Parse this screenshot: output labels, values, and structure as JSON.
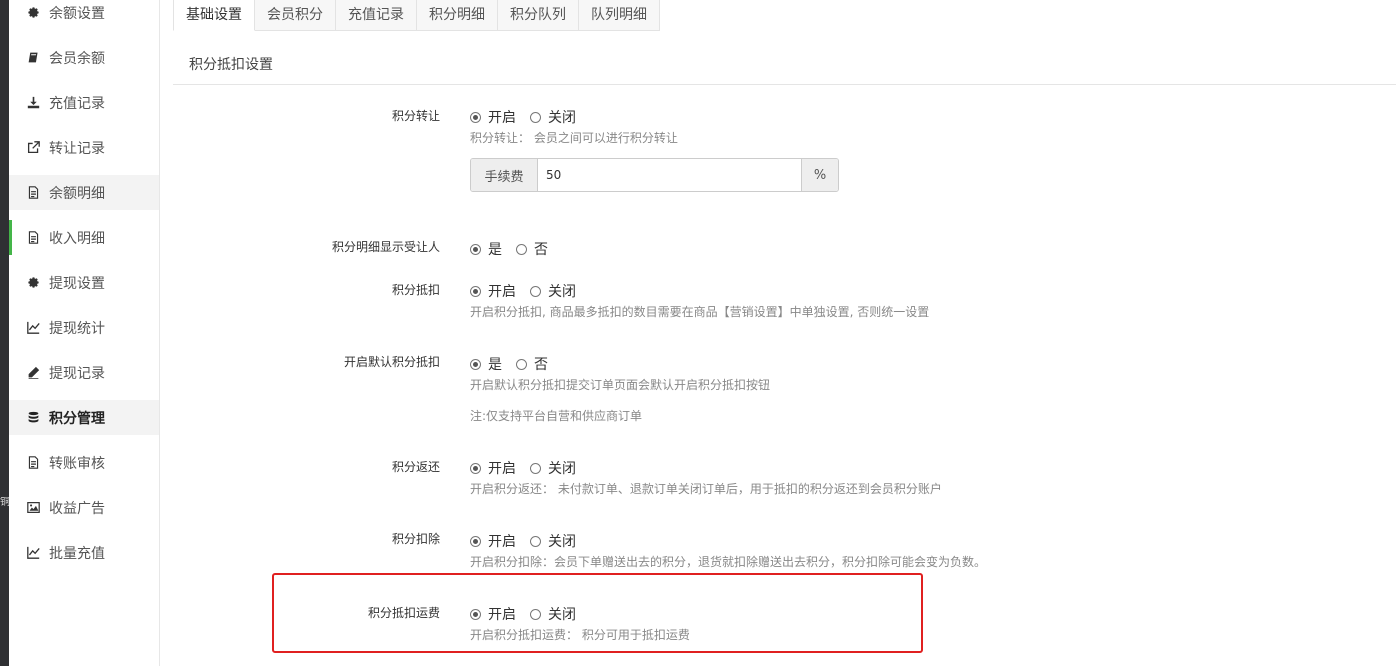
{
  "left_strip_glyph": "铜",
  "sidebar": {
    "items": [
      {
        "label": "余额设置",
        "icon": "gear-icon"
      },
      {
        "label": "会员余额",
        "icon": "book-icon"
      },
      {
        "label": "充值记录",
        "icon": "download-icon"
      },
      {
        "label": "转让记录",
        "icon": "external-link-icon"
      },
      {
        "label": "余额明细",
        "icon": "file-icon"
      },
      {
        "label": "收入明细",
        "icon": "file-icon"
      },
      {
        "label": "提现设置",
        "icon": "gear-icon"
      },
      {
        "label": "提现统计",
        "icon": "line-chart-icon"
      },
      {
        "label": "提现记录",
        "icon": "pencil-icon"
      },
      {
        "label": "积分管理",
        "icon": "database-icon"
      },
      {
        "label": "转账审核",
        "icon": "file-icon"
      },
      {
        "label": "收益广告",
        "icon": "image-icon"
      },
      {
        "label": "批量充值",
        "icon": "line-chart-icon"
      }
    ]
  },
  "tabs": [
    "基础设置",
    "会员积分",
    "充值记录",
    "积分明细",
    "积分队列",
    "队列明细"
  ],
  "section_title": "积分抵扣设置",
  "fields": {
    "transfer": {
      "label": "积分转让",
      "options": [
        "开启",
        "关闭"
      ],
      "selected": 0,
      "help": "积分转让： 会员之间可以进行积分转让",
      "fee_label": "手续费",
      "fee_value": "50",
      "fee_unit": "%"
    },
    "show_receiver": {
      "label": "积分明细显示受让人",
      "options": [
        "是",
        "否"
      ],
      "selected": 0
    },
    "deduct": {
      "label": "积分抵扣",
      "options": [
        "开启",
        "关闭"
      ],
      "selected": 0,
      "help": "开启积分抵扣, 商品最多抵扣的数目需要在商品【营销设置】中单独设置, 否则统一设置"
    },
    "default_deduct": {
      "label": "开启默认积分抵扣",
      "options": [
        "是",
        "否"
      ],
      "selected": 0,
      "help": "开启默认积分抵扣提交订单页面会默认开启积分抵扣按钮",
      "note": "注:仅支持平台自营和供应商订单"
    },
    "refund": {
      "label": "积分返还",
      "options": [
        "开启",
        "关闭"
      ],
      "selected": 0,
      "help": "开启积分返还： 未付款订单、退款订单关闭订单后，用于抵扣的积分返还到会员积分账户"
    },
    "deduct_remove": {
      "label": "积分扣除",
      "options": [
        "开启",
        "关闭"
      ],
      "selected": 0,
      "help": "开启积分扣除：会员下单赠送出去的积分，退货就扣除赠送出去积分，积分扣除可能会变为负数。"
    },
    "freight": {
      "label": "积分抵扣运费",
      "options": [
        "开启",
        "关闭"
      ],
      "selected": 0,
      "help": "开启积分抵扣运费： 积分可用于抵扣运费"
    }
  }
}
